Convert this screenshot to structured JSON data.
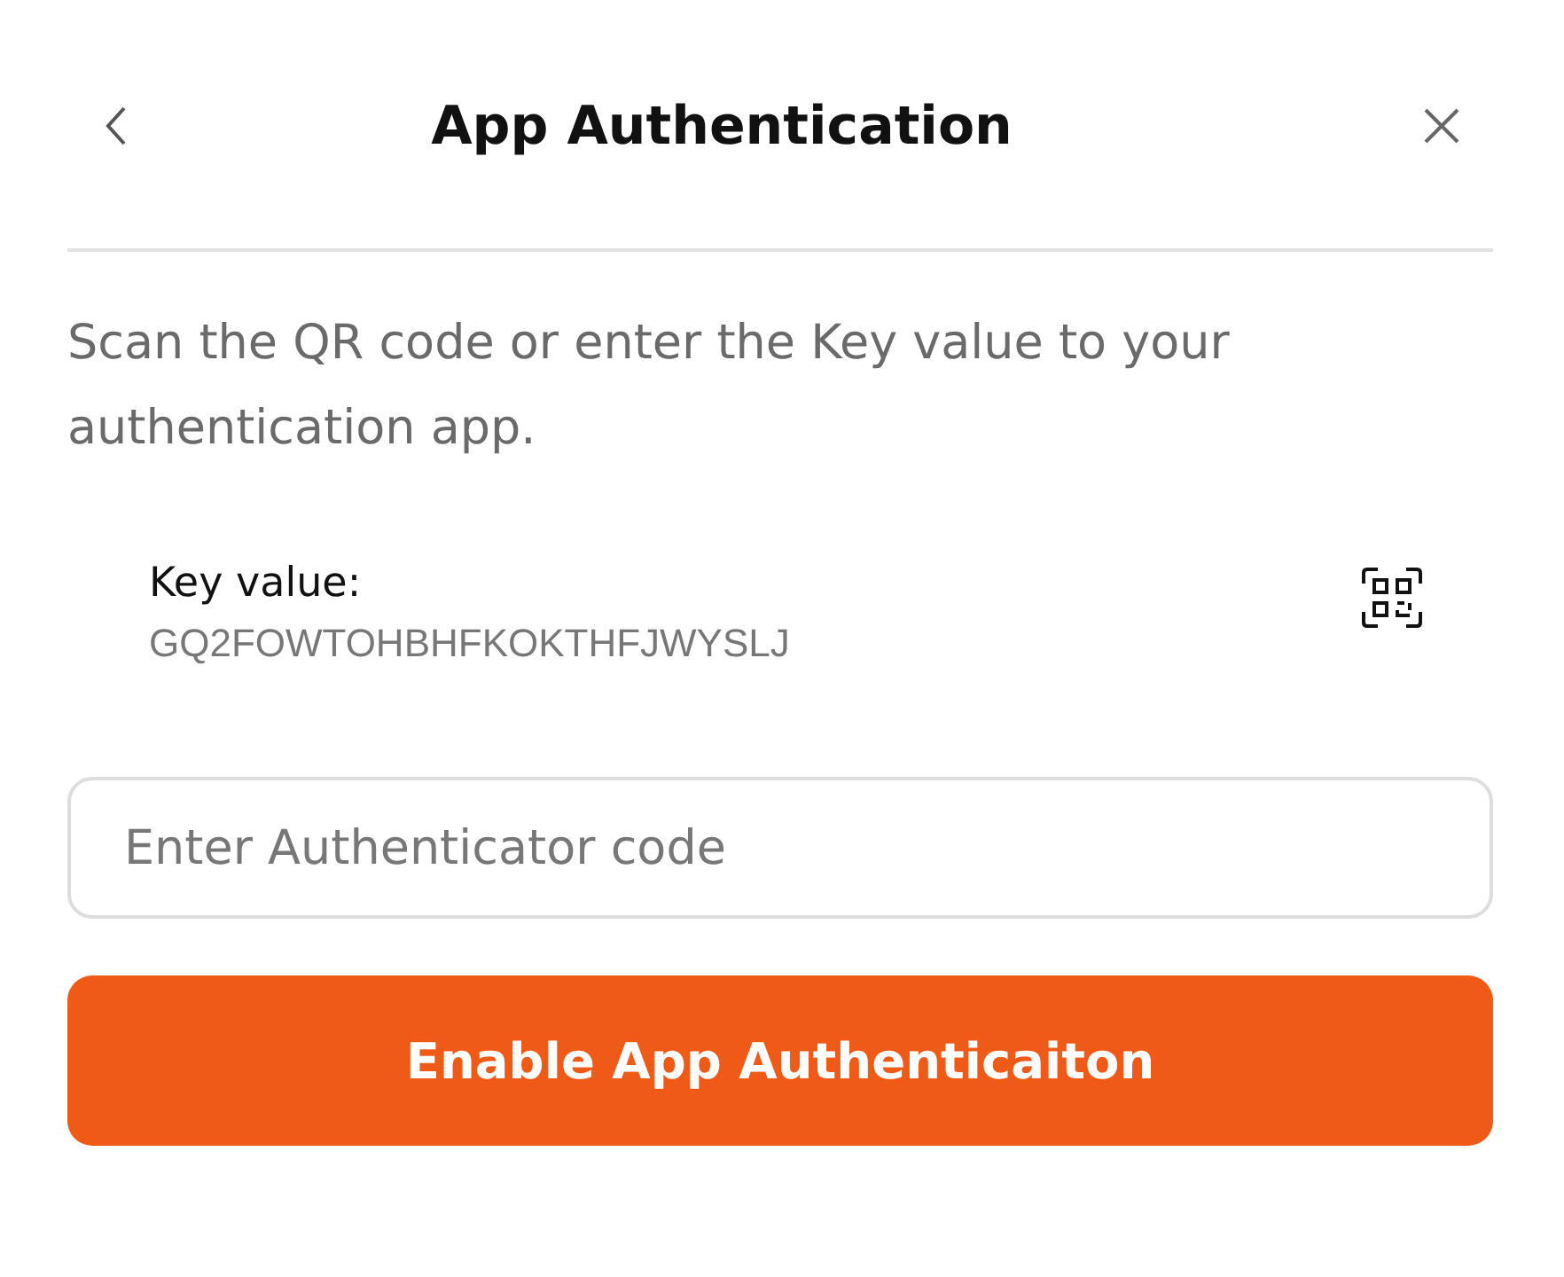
{
  "header": {
    "title": "App Authentication"
  },
  "description": "Scan the QR code or enter the Key value to your authentication app.",
  "key": {
    "label": "Key value:",
    "value": "GQ2FOWTOHBHFKOKTHFJWYSLJ"
  },
  "code_field": {
    "placeholder": "Enter Authenticator code"
  },
  "submit_button": {
    "label": "Enable App Authenticaiton"
  }
}
